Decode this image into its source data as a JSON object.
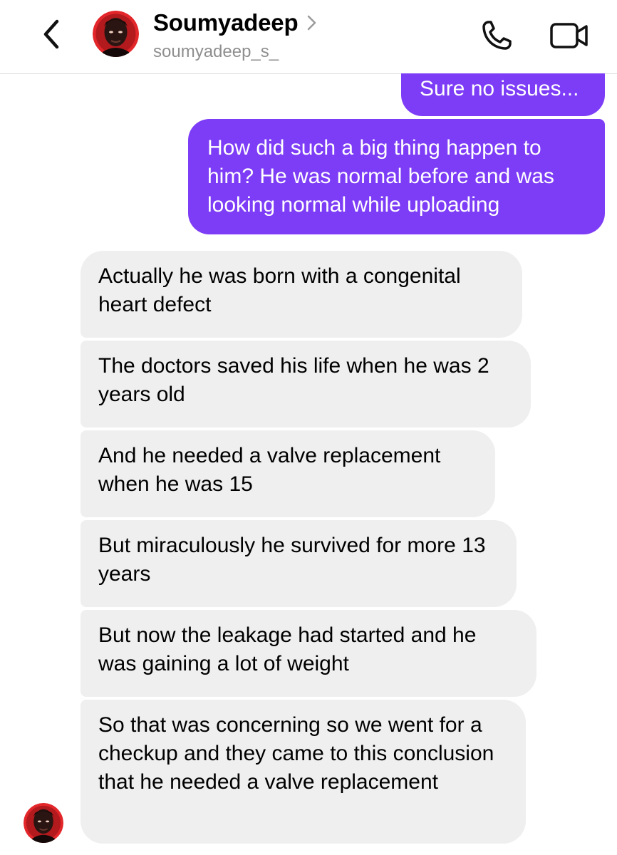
{
  "header": {
    "contact_name": "Soumyadeep",
    "username": "soumyadeep_s_"
  },
  "messages": [
    {
      "sender": "me",
      "text": "Sure no issues..."
    },
    {
      "sender": "me",
      "text": "How did such a big thing happen to him? He was normal before and was looking normal while uploading"
    },
    {
      "sender": "them",
      "text": "Actually he was born with a congenital heart defect"
    },
    {
      "sender": "them",
      "text": "The doctors saved his life when he was 2 years old"
    },
    {
      "sender": "them",
      "text": "And he needed a valve replacement when he was 15"
    },
    {
      "sender": "them",
      "text": "But miraculously he survived for more 13 years"
    },
    {
      "sender": "them",
      "text": "But now the leakage had started and he was gaining a lot of weight"
    },
    {
      "sender": "them",
      "text": "So that was concerning so we went for a checkup and they came to this conclusion that he needed a valve replacement"
    }
  ],
  "icons": {
    "back": "chevron-left-icon",
    "profile_arrow": "chevron-right-icon",
    "call": "phone-icon",
    "video": "video-camera-icon"
  },
  "colors": {
    "sent_bubble": "#7d3cf6",
    "received_bubble": "#efefef",
    "username_gray": "#8e8e8e",
    "avatar_red": "#e3262a"
  }
}
